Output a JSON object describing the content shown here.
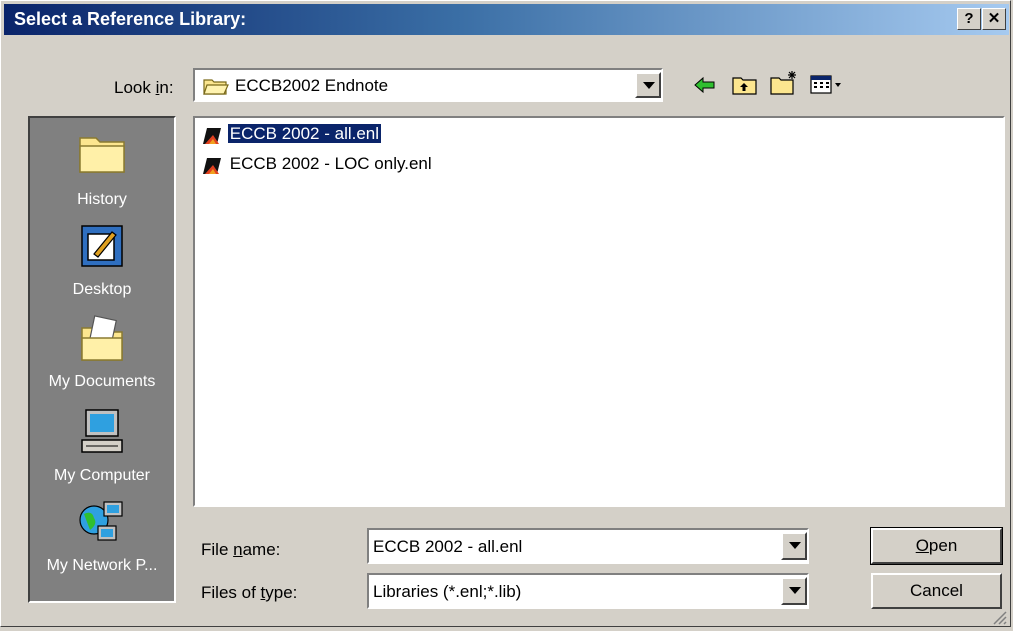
{
  "window": {
    "title": "Select a Reference Library:",
    "help_label": "?",
    "close_label": "✕"
  },
  "look_in": {
    "label_pre": "Look ",
    "label_accel": "i",
    "label_post": "n:",
    "value": "ECCB2002 Endnote"
  },
  "toolbar": {
    "icons": [
      "back-arrow-icon",
      "up-folder-icon",
      "new-folder-icon",
      "view-menu-icon"
    ]
  },
  "places": [
    {
      "label": "History",
      "icon": "history-folder-icon"
    },
    {
      "label": "Desktop",
      "icon": "desktop-icon"
    },
    {
      "label": "My Documents",
      "icon": "my-documents-icon"
    },
    {
      "label": "My Computer",
      "icon": "my-computer-icon"
    },
    {
      "label": "My Network P...",
      "icon": "network-places-icon"
    }
  ],
  "files": [
    {
      "name": "ECCB 2002 - all.enl",
      "selected": true
    },
    {
      "name": "ECCB 2002 - LOC only.enl",
      "selected": false
    }
  ],
  "file_name": {
    "label_pre": "File ",
    "label_accel": "n",
    "label_post": "ame:",
    "value": "ECCB 2002 - all.enl"
  },
  "file_type": {
    "label_pre": "Files of ",
    "label_accel": "t",
    "label_post": "ype:",
    "value": "Libraries (*.enl;*.lib)"
  },
  "buttons": {
    "open_accel": "O",
    "open_rest": "pen",
    "cancel": "Cancel"
  },
  "colors": {
    "title_active": "#0a246a",
    "selection": "#0a246a",
    "face": "#d4d0c8"
  }
}
